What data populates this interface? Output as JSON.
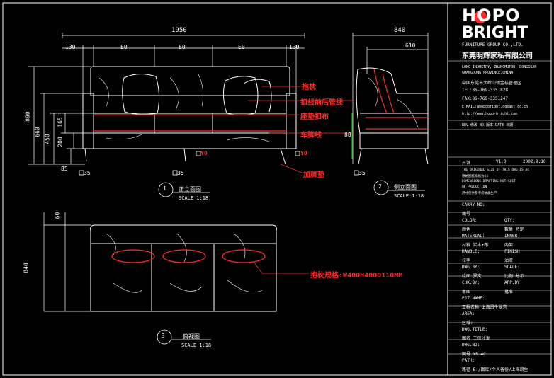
{
  "dimensions": {
    "front_total_width": "1950",
    "front_left_arm": "130",
    "front_right_arm": "130",
    "front_seat_segments": [
      "E0",
      "E0",
      "E0"
    ],
    "front_total_height": "890",
    "front_back_height": "660",
    "front_seat_height": "450",
    "front_cushion": "165",
    "front_seat_base": "200",
    "front_leg": "85",
    "side_total_depth": "840",
    "side_seat_depth": "610",
    "side_pillow_gap": "88",
    "plan_back_depth": "60",
    "plan_total_depth": "840",
    "foot_marks": [
      "35",
      "35",
      "35"
    ],
    "y0_marks": [
      "Y0",
      "Y0"
    ]
  },
  "annotations": {
    "pillow": "抱枕",
    "piping": "扣线前后管线",
    "seat_cloth": "座垫扣布",
    "foot_line": "车脚线",
    "foot_pad": "加脚垫",
    "pillow_spec": "抱枕规格:W400H400D110MM"
  },
  "views": {
    "front": {
      "number": "1",
      "name": "正立面图",
      "scale": "SCALE 1:18"
    },
    "side": {
      "number": "2",
      "name": "侧立面图",
      "scale": "SCALE 1:18"
    },
    "plan": {
      "number": "3",
      "name": "俯视图",
      "scale": "SCALE 1:18"
    }
  },
  "title_block": {
    "brand_line1": "HOPO",
    "brand_line2": "BRIGHT",
    "company_en": "FURNITURE GROUP CO.,LTD.",
    "company_cn": "东莞明辉家私有限公司",
    "address_en": [
      "LONG INDUSTRY, ZHANGMUTOU, DONGGUAN",
      "GUANGDONG PROVINCE,CHINA"
    ],
    "address_cn": "中国东莞市大岭山镇金桔管理区",
    "tel": "TEL:86-769-3351828",
    "fax": "FAX:86-769-3351247",
    "email": "E-MAIL:ahopobright.dgeast.gd.cn",
    "website": "http://www.hopo-bright.com",
    "rev_header": "REV 修改   NO 版本   DATE 日期",
    "dept": "开发",
    "version": "V1.0",
    "date": "2002.9.10",
    "notes": [
      "THE ORIGINAL SIZE OF THIS DWG IS A4",
      "原始图纸规格为A4",
      "DIMENSIONS DRAFTING NOT SUIT",
      "OF PRODUCTION",
      "尺寸仅供参考勿依此生产"
    ],
    "rows": [
      {
        "k": "CARRY NO:",
        "v": ""
      },
      {
        "k": "编号",
        "v": ""
      },
      {
        "k": "COLOR:",
        "v": "QTY:"
      },
      {
        "k": "颜色",
        "v": "数量   特定"
      },
      {
        "k": "MATERIAL:",
        "v": "INNER"
      },
      {
        "k": "材料   实木+布",
        "v": "内架"
      },
      {
        "k": "HANDLE:",
        "v": "FINISH"
      },
      {
        "k": "拉手",
        "v": "油漆"
      },
      {
        "k": "DWG.BY:",
        "v": "SCALE:"
      },
      {
        "k": "绘图   罗文",
        "v": "比例   分示"
      },
      {
        "k": "CHK.BY:",
        "v": "APP.BY:"
      },
      {
        "k": "审图",
        "v": "批准"
      },
      {
        "k": "PJT.NAME:",
        "v": ""
      },
      {
        "k": "工程名称   上海昂生龙宫",
        "v": ""
      },
      {
        "k": "AREA:",
        "v": ""
      },
      {
        "k": "区域:",
        "v": ""
      },
      {
        "k": "DWG.TITLE:",
        "v": ""
      },
      {
        "k": "图名   三位沙发",
        "v": ""
      },
      {
        "k": "DWG.NO:",
        "v": ""
      },
      {
        "k": "图号   YB-4C",
        "v": ""
      },
      {
        "k": "PATH:",
        "v": ""
      },
      {
        "k": "路径   E:/图库/个人备份/上海昂生",
        "v": ""
      }
    ]
  },
  "colors": {
    "outline": "#ffffff",
    "accent": "#ff2a2a",
    "dimension": "#ffffff",
    "frame": "#ffffff",
    "leader": "#ff2a2a",
    "guide": "#00cc00"
  }
}
